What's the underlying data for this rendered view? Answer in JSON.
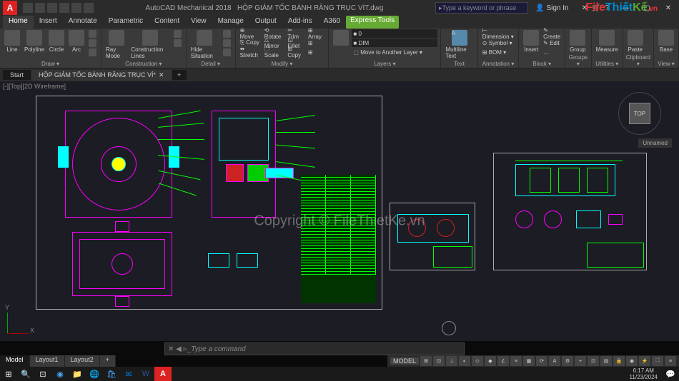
{
  "app": {
    "name": "AutoCAD Mechanical 2018",
    "file": "HỘP GIẢM TỐC BÁNH RĂNG TRỤC VÍT.dwg",
    "logo_letter": "A"
  },
  "search": {
    "placeholder": "Type a keyword or phrase"
  },
  "signin": {
    "label": "Sign In"
  },
  "ribbon_tabs": [
    "Home",
    "Insert",
    "Annotate",
    "Parametric",
    "Content",
    "View",
    "Manage",
    "Output",
    "Add-ins",
    "A360",
    "Express Tools"
  ],
  "ribbon_active": "Home",
  "panels": {
    "draw": {
      "label": "Draw ▾",
      "big": [
        {
          "n": "Line"
        },
        {
          "n": "Polyline"
        },
        {
          "n": "Circle"
        },
        {
          "n": "Arc"
        }
      ]
    },
    "construction": {
      "label": "Construction ▾",
      "big": [
        {
          "n": "Ray Mode"
        },
        {
          "n": "Construction Lines"
        }
      ]
    },
    "detail": {
      "label": "Detail ▾",
      "big": [
        {
          "n": "Hide Situation"
        }
      ]
    },
    "modify": {
      "label": "Modify ▾",
      "rows": [
        [
          "⊕ Move",
          "⟲ Rotate",
          "✂ Trim",
          "⊞ Array"
        ],
        [
          "⎘ Copy",
          "△ Mirror",
          "◱ Fillet",
          "⊞"
        ],
        [
          "⬌ Stretch",
          "⬚ Scale",
          "⊞ Copy",
          "⊞"
        ]
      ]
    },
    "layers": {
      "label": "Layers ▾",
      "rows": [
        [
          "■ 0"
        ],
        [
          "■ DIM"
        ],
        [
          "⬚ Move to Another Layer ▾"
        ]
      ]
    },
    "text": {
      "label": "Text",
      "big": [
        {
          "n": "Multiline Text"
        }
      ]
    },
    "annotation": {
      "label": "Annotation ▾",
      "rows": [
        [
          "⊢ Dimension ▾"
        ],
        [
          "⊙ Symbol ▾"
        ],
        [
          "⊞ BOM ▾"
        ]
      ]
    },
    "block": {
      "label": "Block ▾",
      "big": [
        {
          "n": "Insert"
        }
      ],
      "rows": [
        [
          "✎ Create"
        ],
        [
          "✎ Edit"
        ],
        [
          "…"
        ]
      ]
    },
    "groups": {
      "label": "Groups ▾",
      "big": [
        {
          "n": "Group"
        }
      ]
    },
    "utilities": {
      "label": "Utilities ▾",
      "big": [
        {
          "n": "Measure"
        }
      ]
    },
    "clipboard": {
      "label": "Clipboard ▾",
      "big": [
        {
          "n": "Paste"
        }
      ]
    },
    "view": {
      "label": "View ▾",
      "big": [
        {
          "n": "Base"
        }
      ]
    }
  },
  "file_tabs": {
    "start": "Start",
    "file": "HỘP GIẢM TỐC BÁNH RĂNG TRỤC VÍ*"
  },
  "viewport": {
    "label": "[-][Top][2D Wireframe]"
  },
  "navcube": {
    "face": "TOP",
    "view": "Unnamed"
  },
  "ucs": {
    "x": "X",
    "y": "Y"
  },
  "command": {
    "placeholder": "Type a command"
  },
  "layout_tabs": [
    "Model",
    "Layout1",
    "Layout2",
    "+"
  ],
  "status": {
    "mode": "MODEL"
  },
  "taskbar": {
    "time": "6:17 AM",
    "date": "11/23/2024",
    "start": "⊞"
  },
  "watermark": {
    "logo_file": "File",
    "logo_thiet": "Thiết",
    "logo_ke": "Kế",
    "logo_vn": ".vn",
    "center": "Copyright © FileThietKe.vn"
  }
}
